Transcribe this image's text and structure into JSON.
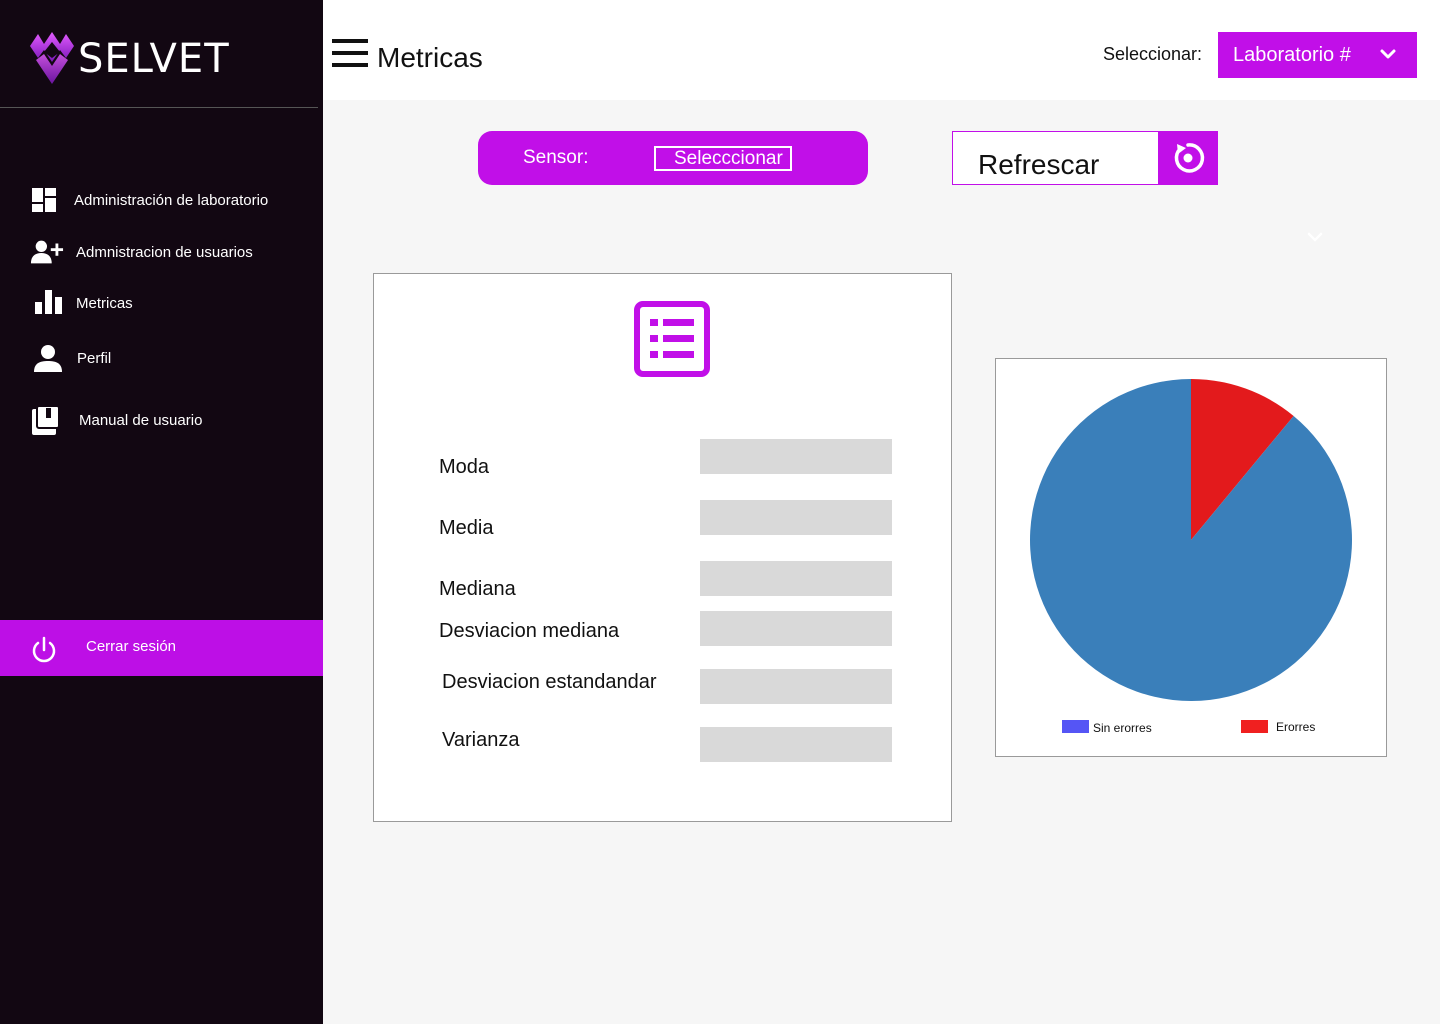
{
  "app": {
    "name": "SELVET"
  },
  "sidebar": {
    "items": [
      {
        "label": "Administración de laboratorio",
        "icon": "dashboard-icon"
      },
      {
        "label": "Admnistracion de usuarios",
        "icon": "add-user-icon"
      },
      {
        "label": "Metricas",
        "icon": "bar-chart-icon"
      },
      {
        "label": "Perfil",
        "icon": "person-icon"
      },
      {
        "label": "Manual de usuario",
        "icon": "book-icon"
      }
    ],
    "logout_label": "Cerrar sesión"
  },
  "header": {
    "title": "Metricas",
    "select_label": "Seleccionar:",
    "lab_value": "Laboratorio #"
  },
  "sensor": {
    "label": "Sensor:",
    "value": "Selecccionar"
  },
  "refresh": {
    "label": "Refrescar"
  },
  "stats": {
    "rows": [
      {
        "label": "Moda",
        "value": ""
      },
      {
        "label": "Media",
        "value": ""
      },
      {
        "label": "Mediana",
        "value": ""
      },
      {
        "label": "Desviacion mediana",
        "value": ""
      },
      {
        "label": "Desviacion estandandar",
        "value": ""
      },
      {
        "label": "Varianza",
        "value": ""
      }
    ]
  },
  "colors": {
    "accent": "#c10fe8",
    "sidebar_bg": "#120712",
    "pie_no_errors": "#3a7fba",
    "pie_errors": "#e31a1c",
    "legend_no_errors": "#5555f5",
    "legend_errors": "#f02020"
  },
  "chart_data": {
    "type": "pie",
    "categories": [
      "Sin erorres",
      "Erorres"
    ],
    "values": [
      89,
      11
    ],
    "legend_position": "bottom"
  }
}
